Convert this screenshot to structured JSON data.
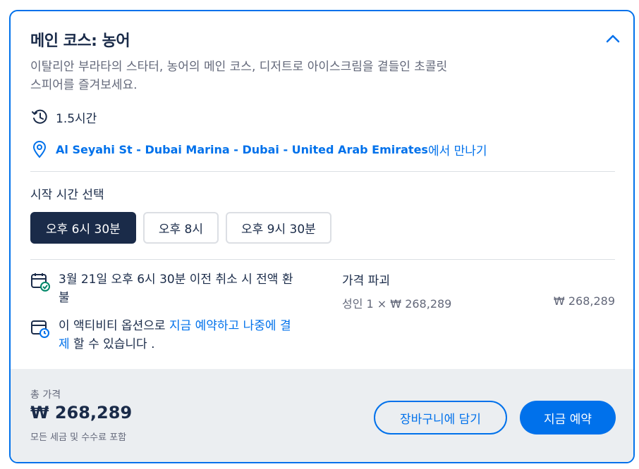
{
  "title": "메인 코스: 농어",
  "description": "이탈리안 부라타의 스타터, 농어의 메인 코스, 디저트로 아이스크림을 곁들인 초콜릿 스피어를 즐겨보세요.",
  "duration": "1.5시간",
  "meeting": {
    "location": "Al Seyahi St - Dubai Marina - Dubai - United Arab Emirates",
    "suffix": "에서 만나기"
  },
  "start_time": {
    "label": "시작 시간 선택",
    "options": [
      "오후 6시 30분",
      "오후 8시",
      "오후 9시 30분"
    ],
    "selected_index": 0
  },
  "cancellation": "3월 21일 오후 6시 30분 이전 취소 시 전액 환불",
  "reserve": {
    "prefix": "이 액티비티 옵션으로 ",
    "link": "지금 예약하고 나중에 결제",
    "suffix": " 할 수 있습니다 ."
  },
  "price_breakdown": {
    "title": "가격 파괴",
    "line_label": "성인 1 × ₩ 268,289",
    "line_total": "₩ 268,289"
  },
  "footer": {
    "total_label": "총 가격",
    "total_price": "₩ 268,289",
    "tax_note": "모든 세금 및 수수료 포함",
    "cart_button": "장바구니에 담기",
    "book_button": "지금 예약"
  },
  "colors": {
    "accent": "#0071eb",
    "navy": "#1a2b49",
    "footer_bg": "#ebeef1"
  },
  "icons": [
    "chevron-up-icon",
    "history-clock-icon",
    "location-pin-icon",
    "calendar-check-icon",
    "calendar-clock-icon"
  ]
}
